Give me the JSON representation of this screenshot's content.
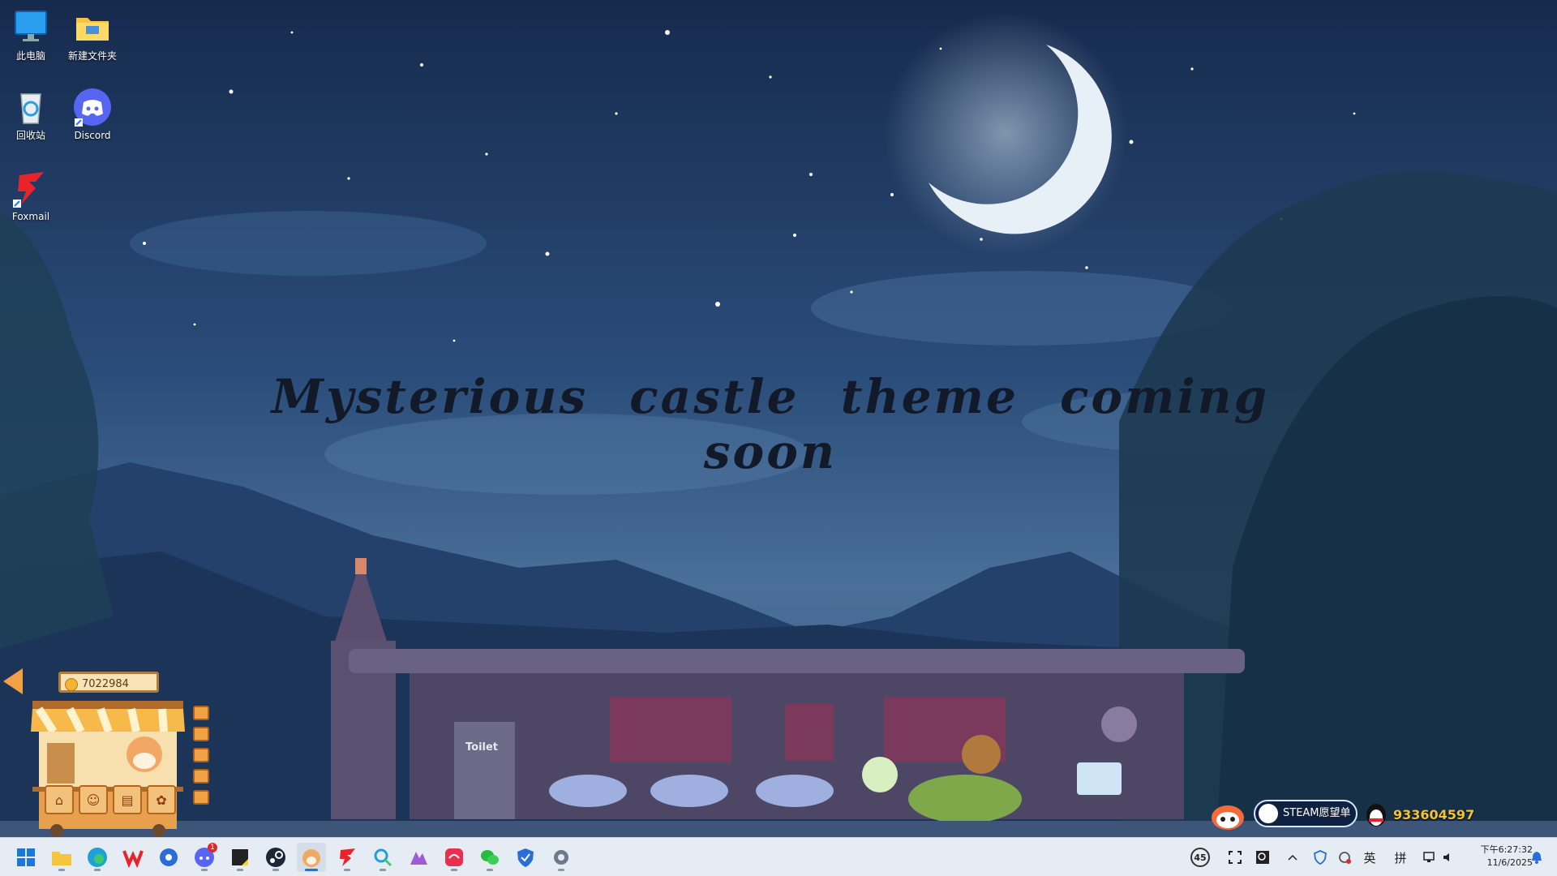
{
  "desktop": {
    "icons": [
      {
        "label": "此电脑",
        "icon": "monitor-icon"
      },
      {
        "label": "新建文件夹",
        "icon": "folder-icon"
      },
      {
        "label": "回收站",
        "icon": "recycle-bin-icon"
      },
      {
        "label": "Discord",
        "icon": "discord-icon"
      },
      {
        "label": "Foxmail",
        "icon": "foxmail-icon"
      }
    ],
    "headline": "Mysterious castle theme coming soon"
  },
  "shop_widget": {
    "coins": "7022984",
    "toilet_sign": "Toilet"
  },
  "tray_widgets": {
    "steam_wishlist": "STEAM愿望单",
    "qq_number": "933604597"
  },
  "taskbar": {
    "apps": [
      {
        "name": "start-icon"
      },
      {
        "name": "file-explorer-icon"
      },
      {
        "name": "edge-browser-icon"
      },
      {
        "name": "wps-office-icon"
      },
      {
        "name": "blue-app-icon"
      },
      {
        "name": "discord-icon",
        "badge": "1"
      },
      {
        "name": "sticky-notes-icon"
      },
      {
        "name": "steam-icon"
      },
      {
        "name": "cat-game-icon"
      },
      {
        "name": "foxmail-icon"
      },
      {
        "name": "search-app-icon"
      },
      {
        "name": "arc-app-icon"
      },
      {
        "name": "red-app-icon"
      },
      {
        "name": "wechat-icon"
      },
      {
        "name": "shield-app-icon"
      },
      {
        "name": "settings-gear-icon"
      }
    ],
    "tray": {
      "temp_badge": "45",
      "lang_1": "英",
      "lang_2": "拼",
      "time": "下午6:27:32",
      "date": "11/6/2025"
    }
  },
  "colors": {
    "sky_top": "#1a2f55",
    "sky_mid": "#3a5f8c",
    "moon": "#e6f0f6",
    "castle": "#5a5170",
    "taskbar": "#e6ecf4",
    "accent": "#2a6dd6"
  }
}
